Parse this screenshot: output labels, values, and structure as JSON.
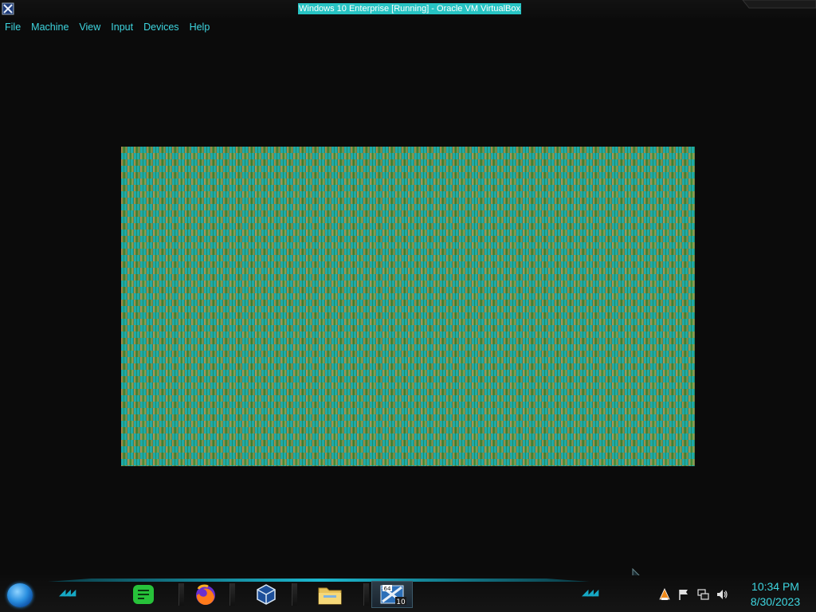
{
  "window": {
    "title": "Windows 10 Enterprise [Running] - Oracle VM VirtualBox"
  },
  "menubar": {
    "items": [
      {
        "label": "File"
      },
      {
        "label": "Machine"
      },
      {
        "label": "View"
      },
      {
        "label": "Input"
      },
      {
        "label": "Devices"
      },
      {
        "label": "Help"
      }
    ]
  },
  "vm_display": {
    "state": "garbled-pattern"
  },
  "taskbar": {
    "start_icon": "start-orb-icon",
    "apps": [
      {
        "name": "notes-app",
        "icon": "notes-icon"
      },
      {
        "name": "firefox",
        "icon": "firefox-icon"
      },
      {
        "name": "virtualbox",
        "icon": "virtualbox-icon"
      },
      {
        "name": "file-explorer",
        "icon": "folder-icon"
      },
      {
        "name": "windows-10-vm",
        "icon": "vm-win10-icon",
        "badge_top": "64",
        "badge_bottom": "10"
      }
    ],
    "tray_icons": [
      "vlc-icon",
      "flag-icon",
      "network-icon",
      "volume-icon"
    ],
    "clock": {
      "time": "10:34 PM",
      "date": "8/30/2023"
    }
  },
  "colors": {
    "accent": "#3ed6e0",
    "title_highlight": "#27c4c4",
    "background": "#0b0b0b"
  }
}
